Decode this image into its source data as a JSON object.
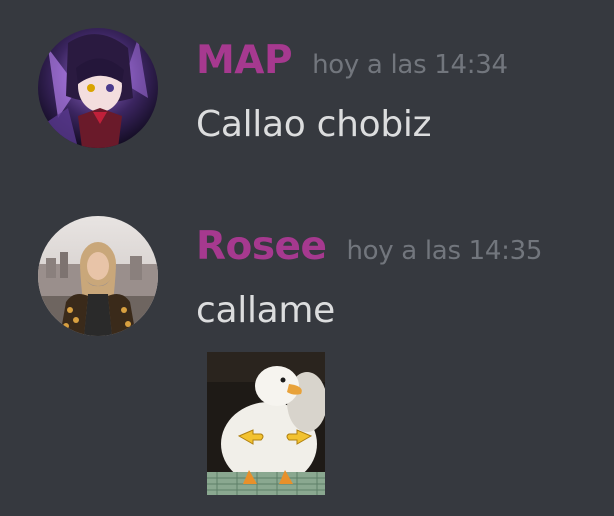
{
  "messages": [
    {
      "username": "MAP",
      "timestamp": "hoy a las 14:34",
      "content": "Callao chobiz",
      "avatar_icon": "anime-character-avatar"
    },
    {
      "username": "Rosee",
      "timestamp": "hoy a las 14:35",
      "content": "callame",
      "avatar_icon": "woman-photo-avatar",
      "attachment_icon": "duck-pointing-image"
    }
  ],
  "colors": {
    "background": "#36393f",
    "username": "#a6398f",
    "timestamp": "#72767d",
    "text": "#dcddde"
  }
}
